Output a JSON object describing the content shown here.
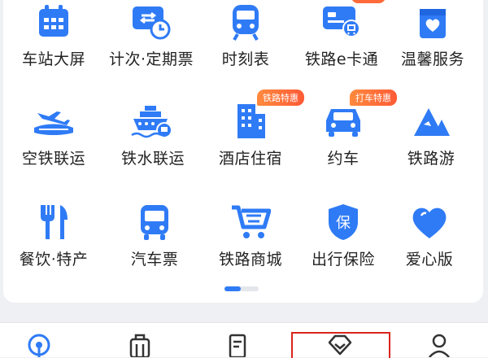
{
  "colors": {
    "accent": "#2f7bf6",
    "tag": "#ff6a3a",
    "highlight_box": "#d9251c"
  },
  "grid": {
    "rows": [
      [
        {
          "label": "车站大屏",
          "icon": "calendar-icon"
        },
        {
          "label": "计次·定期票",
          "icon": "ticket-clock-icon"
        },
        {
          "label": "时刻表",
          "icon": "train-icon"
        },
        {
          "label": "铁路e卡通",
          "icon": "railway-card-icon"
        },
        {
          "label": "温馨服务",
          "icon": "heart-bag-icon"
        }
      ],
      [
        {
          "label": "空铁联运",
          "icon": "plane-train-icon"
        },
        {
          "label": "铁水联运",
          "icon": "ship-train-icon"
        },
        {
          "label": "酒店住宿",
          "icon": "hotel-icon",
          "tag": "铁路特惠"
        },
        {
          "label": "约车",
          "icon": "car-icon",
          "tag": "打车特惠"
        },
        {
          "label": "铁路游",
          "icon": "mountain-icon"
        }
      ],
      [
        {
          "label": "餐饮·特产",
          "icon": "fork-knife-icon"
        },
        {
          "label": "汽车票",
          "icon": "bus-icon"
        },
        {
          "label": "铁路商城",
          "icon": "shopping-cart-icon"
        },
        {
          "label": "出行保险",
          "icon": "insurance-shield-icon",
          "badge_text": "保"
        },
        {
          "label": "爱心版",
          "icon": "heart-icon"
        }
      ]
    ]
  },
  "pager": {
    "current_page": 1,
    "total_pages": 2
  },
  "tabbar": {
    "tabs": [
      {
        "icon": "home-icon"
      },
      {
        "icon": "luggage-icon"
      },
      {
        "icon": "orders-icon"
      },
      {
        "icon": "diamond-icon",
        "highlighted": true
      },
      {
        "icon": "profile-icon"
      }
    ]
  }
}
